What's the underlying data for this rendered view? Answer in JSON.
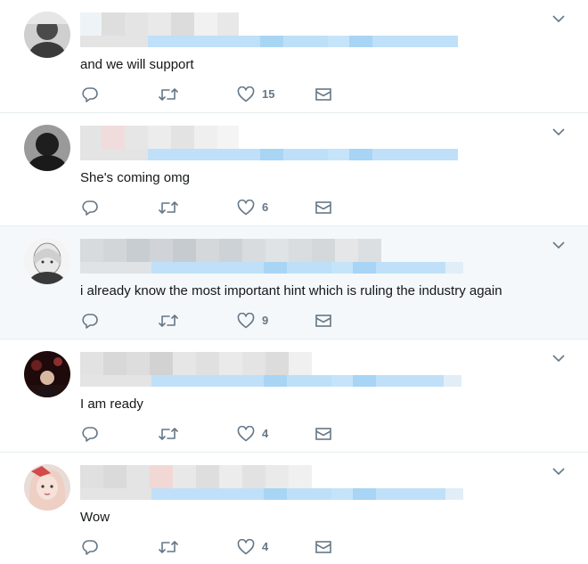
{
  "tweets": [
    {
      "text": "and we will support",
      "likes": "15",
      "avatar_colors": [
        "#5a5a5a",
        "#c9c9c9"
      ]
    },
    {
      "text": "She's coming omg",
      "likes": "6",
      "avatar_colors": [
        "#2c2c2c",
        "#9a9a9a"
      ]
    },
    {
      "text": "i already know the most important hint which is ruling the industry again",
      "likes": "9",
      "avatar_colors": [
        "#f2f2f2",
        "#4a4a4a"
      ]
    },
    {
      "text": "I am ready",
      "likes": "4",
      "avatar_colors": [
        "#3a1010",
        "#7a2a2a"
      ]
    },
    {
      "text": "Wow",
      "likes": "4",
      "avatar_colors": [
        "#f3d6d0",
        "#c96a6a"
      ]
    }
  ],
  "colors": {
    "icon": "#657786",
    "blur_name": "#d9d9d9",
    "blur_handle": "#b3dcf7",
    "hover_bg": "#f5f8fa"
  },
  "icons": {
    "reply": "reply-icon",
    "retweet": "retweet-icon",
    "like": "heart-icon",
    "dm": "envelope-icon",
    "more": "chevron-down-icon"
  }
}
